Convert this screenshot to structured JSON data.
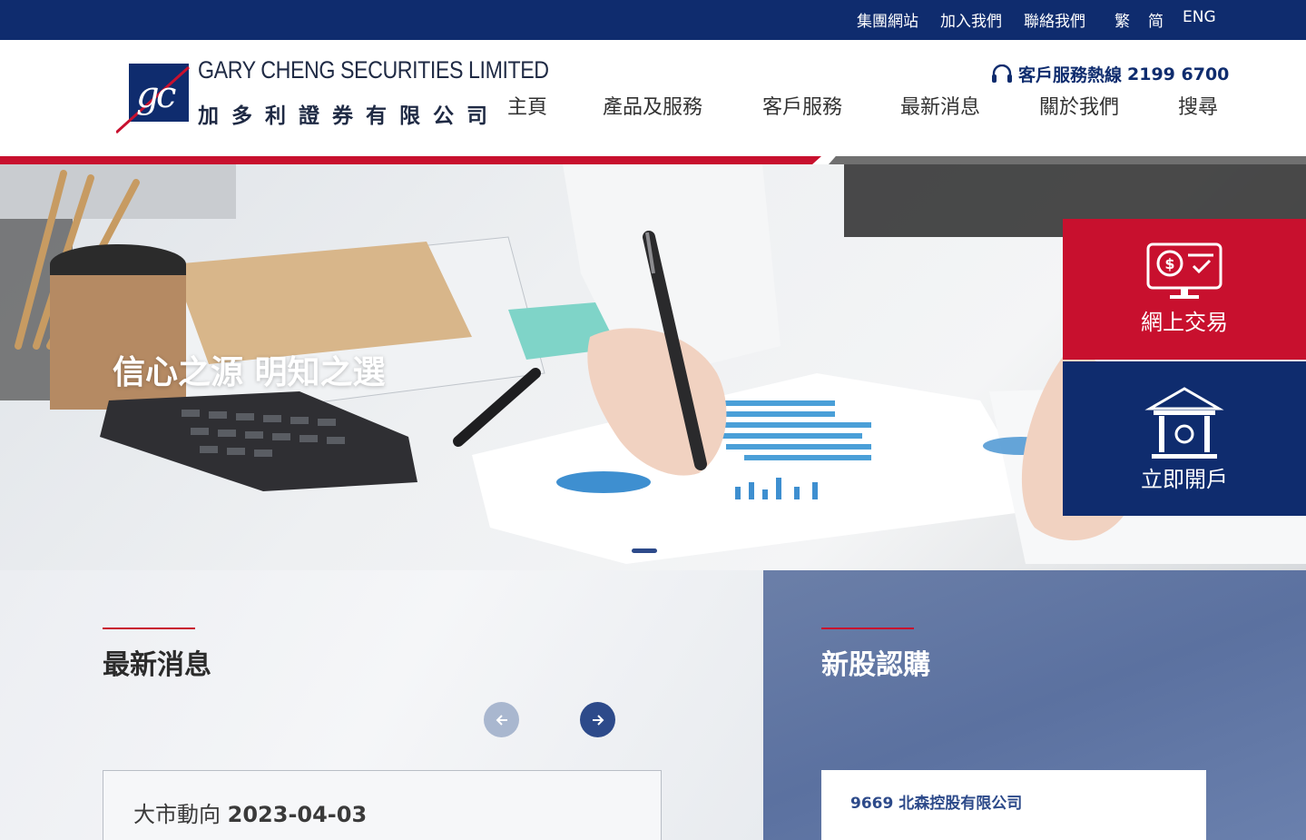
{
  "topbar": {
    "links": [
      "集團網站",
      "加入我們",
      "聯絡我們"
    ],
    "languages": [
      "繁",
      "简",
      "ENG"
    ]
  },
  "brand": {
    "name_en": "GARY CHENG SECURITIES LIMITED",
    "name_zh": "加多利證券有限公司",
    "icon": "gc-monogram-logo"
  },
  "hotline": {
    "label": "客戶服務熱線",
    "number": "2199 6700",
    "icon": "headset-icon"
  },
  "nav": [
    "主頁",
    "產品及服務",
    "客戶服務",
    "最新消息",
    "關於我們",
    "搜尋"
  ],
  "hero": {
    "slogan": "信心之源 明知之選",
    "slides_total": 2,
    "active_slide": 1
  },
  "quick_links": {
    "online_trading": {
      "label": "網上交易",
      "icon": "online-trading-monitor-icon",
      "color": "#c8102e"
    },
    "open_account": {
      "label": "立即開戶",
      "icon": "bank-building-icon",
      "color": "#0f2c6e"
    }
  },
  "news": {
    "title": "最新消息",
    "item_label": "大市動向",
    "item_date": "2023-04-03"
  },
  "ipo": {
    "title": "新股認購",
    "item": "9669 北森控股有限公司"
  },
  "colors": {
    "navy": "#0f2c6e",
    "red": "#c8102e"
  }
}
